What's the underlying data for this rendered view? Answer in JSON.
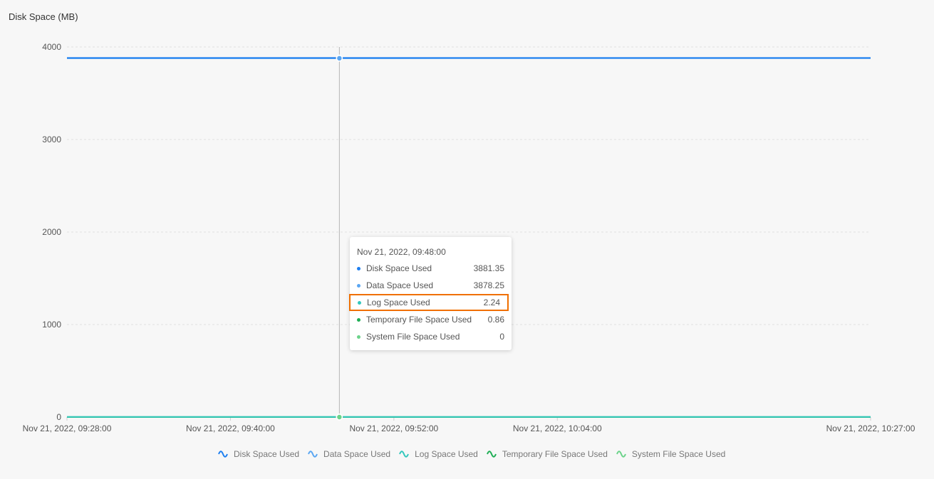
{
  "chart_data": {
    "type": "line",
    "ylabel": "Disk Space (MB)",
    "ylim": [
      0,
      4000
    ],
    "yticks": [
      "0",
      "1000",
      "2000",
      "3000",
      "4000"
    ],
    "xticks": [
      "Nov 21, 2022, 09:28:00",
      "Nov 21, 2022, 09:40:00",
      "Nov 21, 2022, 09:52:00",
      "Nov 21, 2022, 10:04:00",
      "Nov 21, 2022, 10:27:00"
    ],
    "xtick_minutes": [
      0,
      12,
      24,
      36,
      59
    ],
    "xlim_minutes": [
      0,
      59
    ],
    "x_minutes": [
      0,
      12,
      20,
      24,
      36,
      59
    ],
    "grid": true,
    "legend_position": "bottom",
    "series": [
      {
        "name": "Disk Space Used",
        "color": "#1e7ff0",
        "values": [
          3881.3,
          3881.3,
          3881.35,
          3881.4,
          3881.6,
          3882.0
        ]
      },
      {
        "name": "Data Space Used",
        "color": "#5aa6f2",
        "values": [
          3878.2,
          3878.2,
          3878.25,
          3878.3,
          3878.5,
          3878.9
        ]
      },
      {
        "name": "Log Space Used",
        "color": "#33c7bd",
        "values": [
          2.24,
          2.24,
          2.24,
          2.24,
          2.24,
          2.24
        ]
      },
      {
        "name": "Temporary File Space Used",
        "color": "#1fae55",
        "values": [
          0.86,
          0.86,
          0.86,
          0.86,
          0.86,
          0.86
        ]
      },
      {
        "name": "System File Space Used",
        "color": "#6cd38a",
        "values": [
          0,
          0,
          0,
          0,
          0,
          0
        ]
      }
    ],
    "hover": {
      "minute": 20
    }
  },
  "tooltip": {
    "title": "Nov 21, 2022, 09:48:00",
    "rows": [
      {
        "label": "Disk Space Used",
        "value": "3881.35",
        "color": "#1e7ff0"
      },
      {
        "label": "Data Space Used",
        "value": "3878.25",
        "color": "#5aa6f2"
      },
      {
        "label": "Log Space Used",
        "value": "2.24",
        "color": "#33c7bd"
      },
      {
        "label": "Temporary File Space Used",
        "value": "0.86",
        "color": "#1fae55"
      },
      {
        "label": "System File Space Used",
        "value": "0",
        "color": "#6cd38a"
      }
    ]
  }
}
